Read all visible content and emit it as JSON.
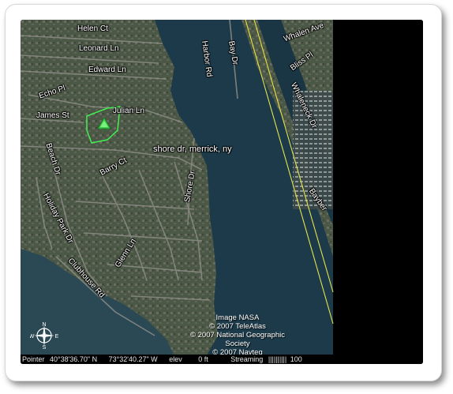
{
  "location_label": "shore dr, merrick, ny",
  "street_labels": [
    {
      "id": "helen-ct",
      "text": "Helen Ct"
    },
    {
      "id": "leonard-ln",
      "text": "Leonard Ln"
    },
    {
      "id": "edward-ln",
      "text": "Edward Ln"
    },
    {
      "id": "echo-pl",
      "text": "Echo Pl"
    },
    {
      "id": "james-st",
      "text": "James St"
    },
    {
      "id": "julian-ln",
      "text": "Julian Ln"
    },
    {
      "id": "barry-ct",
      "text": "Barry Ct"
    },
    {
      "id": "shore-dr",
      "text": "Shore Dr"
    },
    {
      "id": "beach-dr",
      "text": "Beach Dr"
    },
    {
      "id": "holiday-park-dr",
      "text": "Holiday Park Dr"
    },
    {
      "id": "glenn-ln",
      "text": "Glenn Ln"
    },
    {
      "id": "clubhouse-rd",
      "text": "Clubhouse Rd"
    },
    {
      "id": "harbor-rd",
      "text": "Harbor Rd"
    },
    {
      "id": "bay-dr",
      "text": "Bay Dr"
    },
    {
      "id": "whaleneck-dr",
      "text": "Whaleneck Dr"
    },
    {
      "id": "whalen-ave",
      "text": "Whalen Ave"
    },
    {
      "id": "bliss-pl",
      "text": "Bliss Pl"
    },
    {
      "id": "bayberry",
      "text": "Bayber"
    }
  ],
  "credits": [
    "Image NASA",
    "© 2007 TeleAtlas",
    "© 2007 National Geographic Society",
    "© 2007 Navteq"
  ],
  "status": {
    "pointer_label": "Pointer",
    "latitude": "40°38'36.70\" N",
    "longitude": "73°32'40.27\" W",
    "elev_label": "elev",
    "elev_value": "0 ft",
    "streaming_label": "Streaming",
    "streaming_bar": "||||||||||",
    "streaming_pct": "100"
  },
  "compass": {
    "n": "N",
    "s": "S",
    "e": "E",
    "w": "W"
  },
  "colors": {
    "water": "#1b3a4a",
    "land": "#4d5a45",
    "highlight": "#44ee55",
    "boundary": "#e6e34a"
  }
}
